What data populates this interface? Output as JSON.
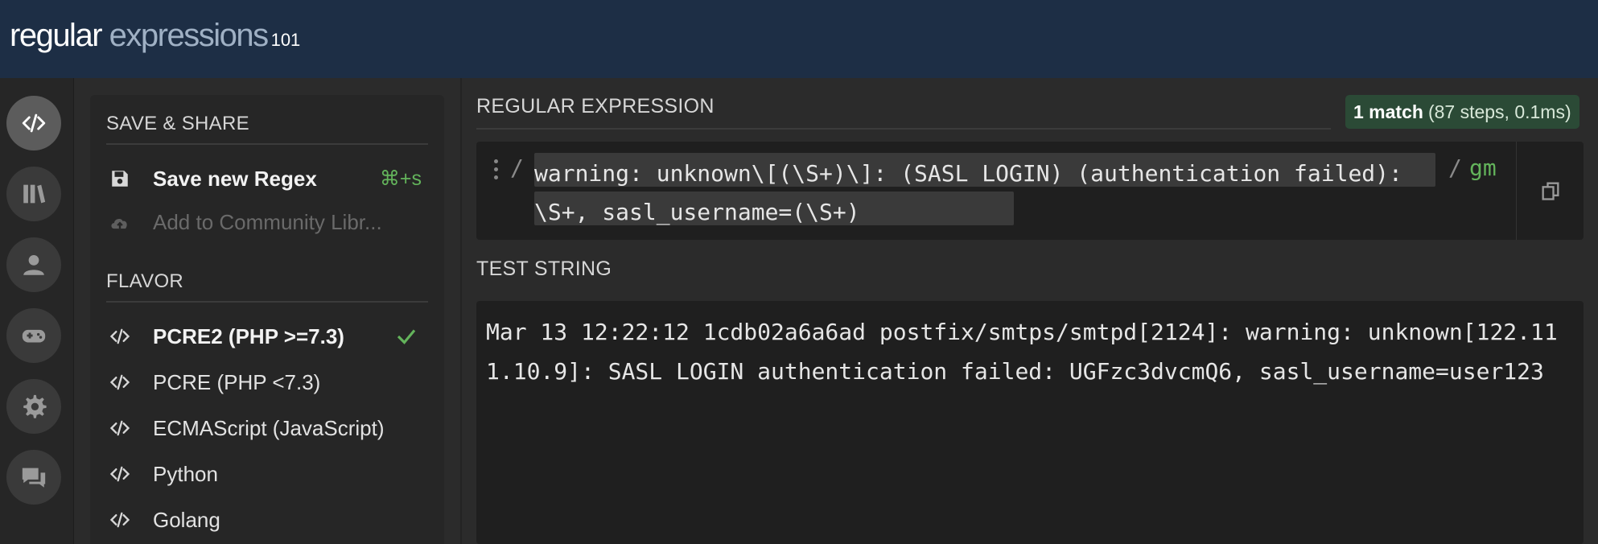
{
  "header": {
    "logo_part1": "regular",
    "logo_part2": " expressions",
    "logo_part3": "101"
  },
  "iconbar": {
    "items": [
      {
        "name": "regex-editor",
        "icon": "code-icon",
        "active": true
      },
      {
        "name": "library",
        "icon": "library-icon"
      },
      {
        "name": "account",
        "icon": "user-icon"
      },
      {
        "name": "quiz",
        "icon": "gamepad-icon"
      },
      {
        "name": "settings",
        "icon": "gear-icon"
      },
      {
        "name": "community",
        "icon": "chat-icon"
      }
    ]
  },
  "sidebar": {
    "save_share_title": "SAVE & SHARE",
    "save_label": "Save new Regex",
    "save_shortcut": "⌘+s",
    "community_label": "Add to Community Libr...",
    "flavor_title": "FLAVOR",
    "flavors": [
      {
        "label": "PCRE2 (PHP >=7.3)",
        "selected": true
      },
      {
        "label": "PCRE (PHP <7.3)"
      },
      {
        "label": "ECMAScript (JavaScript)"
      },
      {
        "label": "Python"
      },
      {
        "label": "Golang"
      }
    ]
  },
  "regex": {
    "title": "REGULAR EXPRESSION",
    "match_count": "1 match",
    "match_info": "(87 steps, 0.1ms)",
    "delimiter_open": "/",
    "delimiter_close": "/",
    "flags": "gm",
    "pattern": "warning: unknown\\[(\\S+)\\]: (SASL LOGIN) (authentication failed): \\S+, sasl_username=(\\S+)"
  },
  "test_string": {
    "title": "TEST STRING",
    "value": "Mar 13 12:22:12 1cdb02a6a6ad postfix/smtps/smtpd[2124]: warning: unknown[122.111.10.9]: SASL LOGIN authentication failed: UGFzc3dvcmQ6, sasl_username=user123"
  },
  "colors": {
    "accent_green": "#63b35b",
    "header_bg": "#1d2e45",
    "match_bg": "#2b4368"
  }
}
